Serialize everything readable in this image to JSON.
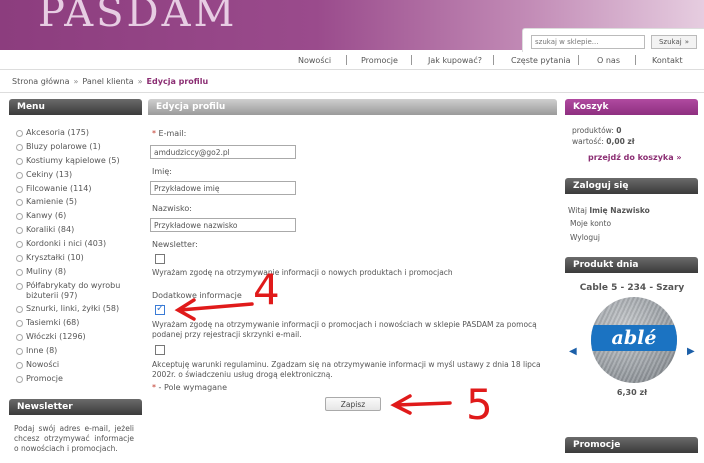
{
  "header": {
    "logo": "PASDAM"
  },
  "search": {
    "placeholder": "szukaj w sklepie...",
    "button_label": "Szukaj",
    "button_icon": "double-chevron-right-icon"
  },
  "topnav": {
    "items": [
      "Nowości",
      "Promocje",
      "Jak kupować?",
      "Częste pytania",
      "O nas",
      "Kontakt"
    ]
  },
  "breadcrumb": {
    "items": [
      "Strona główna",
      "Panel klienta",
      "Edycja profilu"
    ],
    "separator": "»"
  },
  "menu": {
    "title": "Menu",
    "items": [
      "Akcesoria (175)",
      "Bluzy polarowe (1)",
      "Kostiumy kąpielowe (5)",
      "Ceki­ny (13)",
      "Filcowanie (114)",
      "Kamienie (5)",
      "Kanwy (6)",
      "Koraliki (84)",
      "Kordonki i nici (403)",
      "Kryształki (10)",
      "Muliny (8)",
      "Półfabrykaty do wyrobu biżuterii (97)",
      "Sznurki, linki, żyłki (58)",
      "Tasiemki (68)",
      "Włóczki (1296)",
      "Inne (8)",
      "Nowości",
      "Promocje"
    ]
  },
  "newsletter": {
    "title": "Newsletter",
    "text": "Podaj swój adres e-mail, jeżeli chcesz otrzymywać informacje o nowościach i promocjach."
  },
  "profile": {
    "title": "Edycja profilu",
    "email_label": "E-mail:",
    "email_value": "amdudziccy@go2.pl",
    "first_name_label": "Imię:",
    "first_name_value": "Przykładowe imię",
    "last_name_label": "Nazwisko:",
    "last_name_value": "Przykładowe nazwisko",
    "newsletter_label": "Newsletter:",
    "newsletter_text": "Wyrażam zgodę na otrzymywanie informacji o nowych produktach i promocjach",
    "extra_label": "Dodatkowe informacje",
    "extra_text": "Wyrażam zgodę na otrzymywanie informacji o promocjach i nowościach w sklepie PASDAM za pomocą podanej przy rejestracji skrzynki e-mail.",
    "terms_text": "Akceptuję warunki regulaminu. Zgadzam się na otrzymywanie informacji w myśl ustawy z dnia 18 lipca 2002r. o świadczeniu usług drogą elektroniczną.",
    "required_note": "- Pole wymagane",
    "required_mark": "*",
    "save_label": "Zapisz"
  },
  "annotations": {
    "four": "4",
    "five": "5",
    "color": "#e01a1a"
  },
  "cart": {
    "title": "Koszyk",
    "products_label": "produktów:",
    "products_value": "0",
    "value_label": "wartość:",
    "value_value": "0,00 zł",
    "link": "przejdź do koszyka »"
  },
  "login": {
    "title": "Zaloguj się",
    "greeting": "Witaj",
    "user_name": "Imię Nazwisko",
    "account_link": "Moje konto",
    "logout_link": "Wyloguj"
  },
  "product_of_day": {
    "title": "Produkt dnia",
    "name": "Cable 5 - 234 - Szary",
    "brand_on_label": "ablé",
    "price": "6,30 zł"
  },
  "promo": {
    "title": "Promocje"
  },
  "colors": {
    "brand": "#8b2e73",
    "header_purple": "#9a4b8c",
    "link_blue": "#1b5fa8"
  }
}
